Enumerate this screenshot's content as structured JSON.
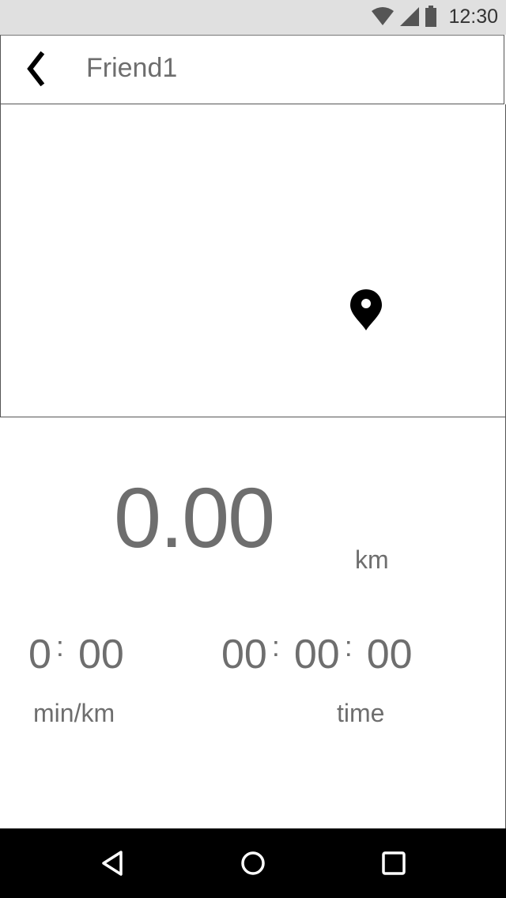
{
  "status_bar": {
    "time": "12:30",
    "icons": [
      "wifi-icon",
      "signal-icon",
      "battery-icon"
    ]
  },
  "header": {
    "back_icon": "chevron-left-icon",
    "title": "Friend1"
  },
  "map": {
    "marker_icon": "map-pin-icon"
  },
  "stats": {
    "distance": "0.00",
    "distance_unit": "km",
    "pace": {
      "min": "0",
      "sec": "00"
    },
    "pace_label": "min/km",
    "time": {
      "h": "00",
      "m": "00",
      "s": "00"
    },
    "time_label": "time"
  },
  "nav_bar": {
    "icons": [
      "back-triangle-icon",
      "home-circle-icon",
      "recents-square-icon"
    ]
  },
  "colors": {
    "status_bar_bg": "#e0e0e0",
    "nav_bar_bg": "#000000",
    "text_gray": "#6e6e6e"
  }
}
